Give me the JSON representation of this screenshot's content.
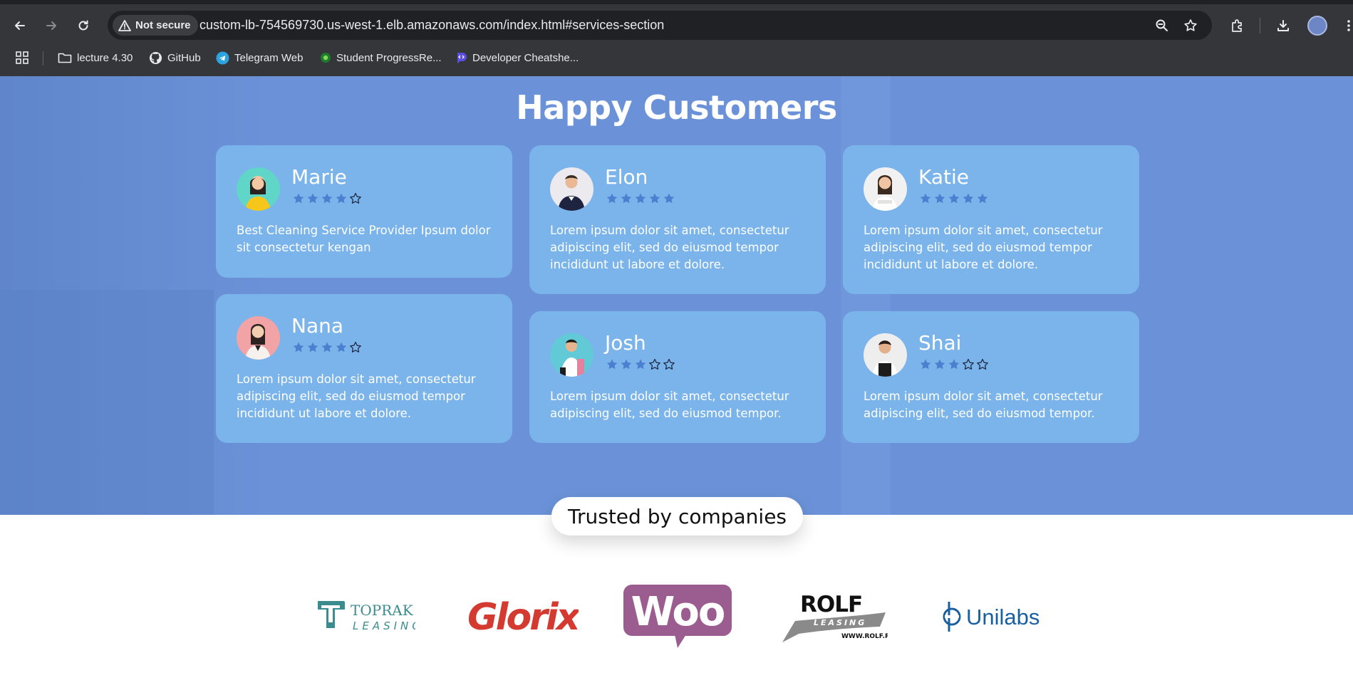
{
  "browser": {
    "security_label": "Not secure",
    "url": "custom-lb-754569730.us-west-1.elb.amazonaws.com/index.html#services-section",
    "bookmarks": [
      {
        "label": "lecture 4.30",
        "icon": "folder-icon"
      },
      {
        "label": "GitHub",
        "icon": "github-icon"
      },
      {
        "label": "Telegram Web",
        "icon": "telegram-icon"
      },
      {
        "label": "Student ProgressRe...",
        "icon": "progress-icon"
      },
      {
        "label": "Developer Cheatshe...",
        "icon": "devcheat-icon"
      }
    ]
  },
  "customers": {
    "title": "Happy Customers",
    "cards": [
      {
        "name": "Marie",
        "rating": 4,
        "max": 5,
        "text": "Best Cleaning Service Provider Ipsum dolor sit consectetur kengan"
      },
      {
        "name": "Elon",
        "rating": 5,
        "max": 5,
        "text": "Lorem ipsum dolor sit amet, consectetur adipiscing elit, sed do eiusmod tempor incididunt ut labore et dolore."
      },
      {
        "name": "Katie",
        "rating": 5,
        "max": 5,
        "text": "Lorem ipsum dolor sit amet, consectetur adipiscing elit, sed do eiusmod tempor incididunt ut labore et dolore."
      },
      {
        "name": "Nana",
        "rating": 4,
        "max": 5,
        "text": "Lorem ipsum dolor sit amet, consectetur adipiscing elit, sed do eiusmod tempor incididunt ut labore et dolore."
      },
      {
        "name": "Josh",
        "rating": 3,
        "max": 5,
        "text": "Lorem ipsum dolor sit amet, consectetur adipiscing elit, sed do eiusmod tempor."
      },
      {
        "name": "Shai",
        "rating": 3,
        "max": 5,
        "text": "Lorem ipsum dolor sit amet, consectetur adipiscing elit, sed do eiusmod tempor."
      }
    ]
  },
  "trusted": {
    "title": "Trusted by companies",
    "logos": [
      {
        "word": "TOPRAK",
        "sub": "LEASING"
      },
      {
        "word": "Glorix"
      },
      {
        "word": "Woo"
      },
      {
        "word": "ROLF",
        "sub": "LEASING",
        "url": "WWW.ROLF.RU"
      },
      {
        "word": "Unilabs"
      }
    ]
  },
  "colors": {
    "hero": "#6b92d8",
    "card": "#7ab4ea",
    "star": "#4b7fd0"
  }
}
